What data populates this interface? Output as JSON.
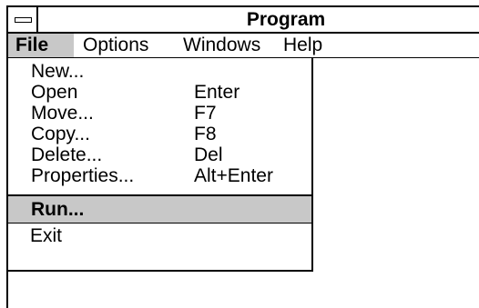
{
  "window": {
    "title": "Program"
  },
  "menubar": {
    "items": [
      {
        "label": "File",
        "active": true
      },
      {
        "label": "Options",
        "active": false
      },
      {
        "label": "Windows",
        "active": false
      },
      {
        "label": "Help",
        "active": false
      }
    ]
  },
  "file_menu": {
    "items": [
      {
        "label": "New...",
        "accelerator": ""
      },
      {
        "label": "Open",
        "accelerator": "Enter"
      },
      {
        "label": "Move...",
        "accelerator": "F7"
      },
      {
        "label": "Copy...",
        "accelerator": "F8"
      },
      {
        "label": "Delete...",
        "accelerator": "Del"
      },
      {
        "label": "Properties...",
        "accelerator": "Alt+Enter"
      }
    ],
    "run_label": "Run...",
    "exit_label": "Exit"
  },
  "colors": {
    "highlight": "#c8c8c8",
    "border": "#000000",
    "background": "#ffffff"
  }
}
